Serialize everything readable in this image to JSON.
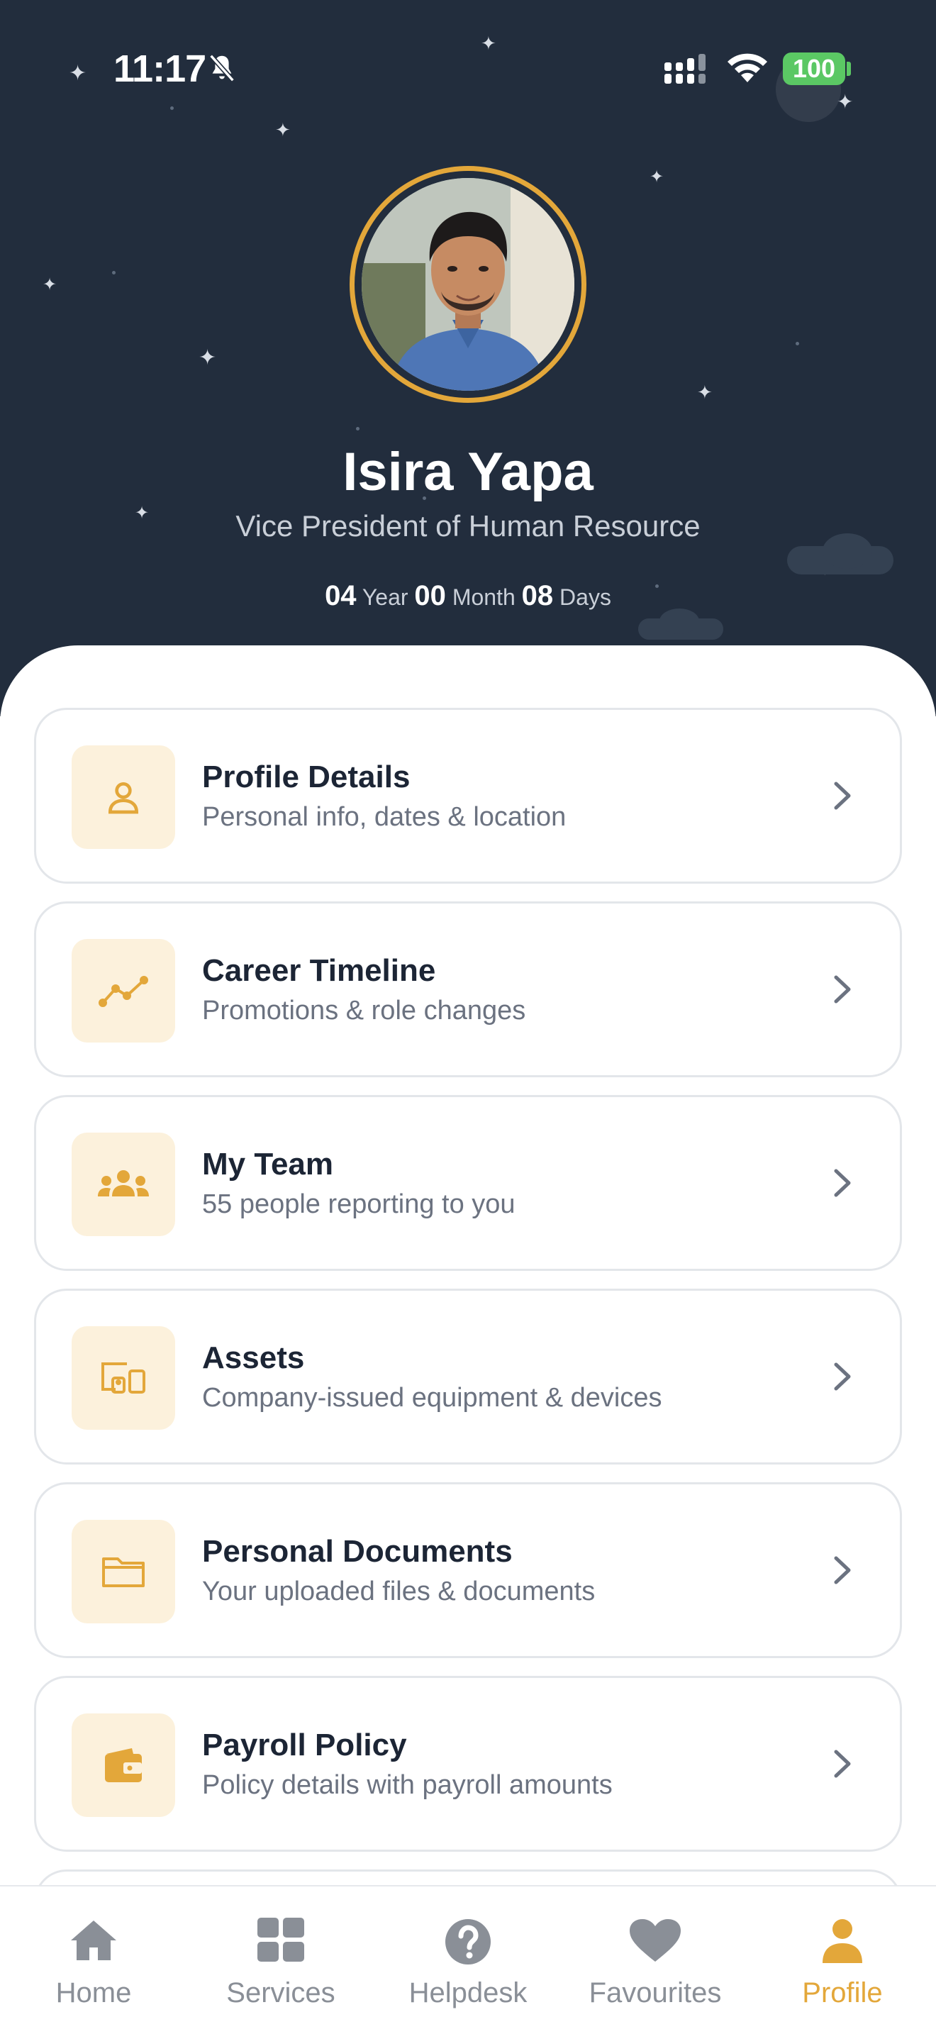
{
  "status_bar": {
    "time": "11:17",
    "battery": "100"
  },
  "profile": {
    "name": "Isira Yapa",
    "designation": "Vice President of Human Resource",
    "tenure": {
      "years": "04",
      "years_label": "Year",
      "months": "00",
      "months_label": "Month",
      "days": "08",
      "days_label": "Days"
    }
  },
  "menu": {
    "items": [
      {
        "title": "Profile Details",
        "subtitle": "Personal info, dates & location",
        "icon": "person-icon"
      },
      {
        "title": "Career Timeline",
        "subtitle": "Promotions & role changes",
        "icon": "trend-line-icon"
      },
      {
        "title": "My Team",
        "subtitle": "55 people reporting to you",
        "icon": "group-icon"
      },
      {
        "title": "Assets",
        "subtitle": "Company-issued equipment & devices",
        "icon": "devices-icon"
      },
      {
        "title": "Personal Documents",
        "subtitle": "Your uploaded files & documents",
        "icon": "folder-icon"
      },
      {
        "title": "Payroll Policy",
        "subtitle": "Policy details with payroll amounts",
        "icon": "wallet-icon"
      }
    ]
  },
  "tabbar": {
    "tabs": [
      {
        "label": "Home",
        "icon": "home-icon"
      },
      {
        "label": "Services",
        "icon": "grid-icon"
      },
      {
        "label": "Helpdesk",
        "icon": "help-icon"
      },
      {
        "label": "Favourites",
        "icon": "heart-icon"
      },
      {
        "label": "Profile",
        "icon": "user-icon"
      }
    ],
    "active": "Profile"
  },
  "colors": {
    "header_bg": "#222d3d",
    "accent": "#e3a73a",
    "icon_tile_bg": "#fcf1dc",
    "battery_green": "#5bc864"
  }
}
